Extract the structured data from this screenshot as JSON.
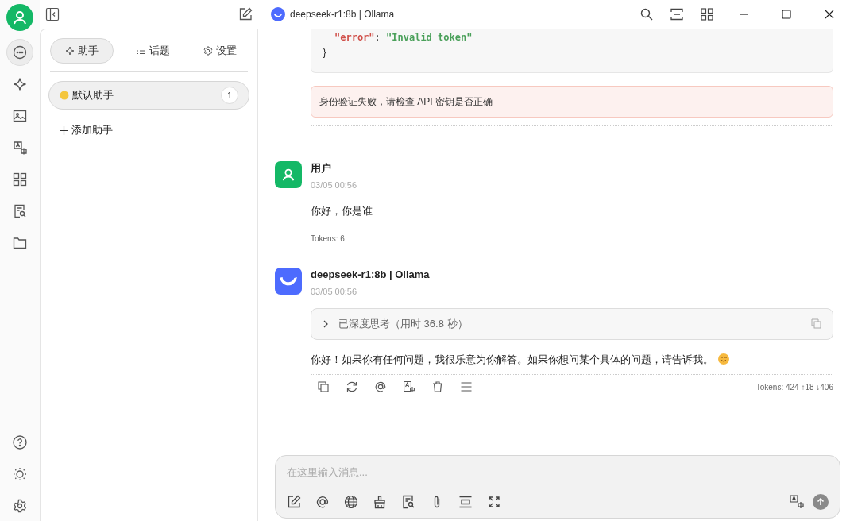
{
  "window": {
    "title": "deepseek-r1:8b | Ollama"
  },
  "rail": [
    {
      "kind": "chat",
      "selected": true
    },
    {
      "kind": "sparkle",
      "selected": false
    },
    {
      "kind": "image",
      "selected": false
    },
    {
      "kind": "translate",
      "selected": false
    },
    {
      "kind": "apps",
      "selected": false
    },
    {
      "kind": "docsearch",
      "selected": false
    },
    {
      "kind": "folder",
      "selected": false
    }
  ],
  "panel": {
    "tabs": [
      {
        "label": "助手",
        "kind": "sparkle",
        "selected": true
      },
      {
        "label": "话题",
        "kind": "list",
        "selected": false
      },
      {
        "label": "设置",
        "kind": "gear",
        "selected": false
      }
    ],
    "assistants": [
      {
        "name": "默认助手",
        "count": "1",
        "selected": true
      }
    ],
    "add_button": "添加助手"
  },
  "code_block": {
    "lines": [
      [
        {
          "text": "\"error\"",
          "kind": "key"
        },
        {
          "text": ": ",
          "kind": "punct"
        },
        {
          "text": "\"Invalid token\"",
          "kind": "string"
        }
      ],
      [
        {
          "text": "}",
          "kind": "punct"
        }
      ]
    ]
  },
  "error_alert": "身份验证失败，请检查 API 密钥是否正确",
  "messages": [
    {
      "kind": "user",
      "name": "用户",
      "time": "03/05 00:56",
      "text": "你好，你是谁",
      "tokens": "Tokens: 6"
    },
    {
      "kind": "assistant",
      "name": "deepseek-r1:8b | Ollama",
      "time": "03/05 00:56",
      "thinking": {
        "label": "已深度思考（用时 36.8 秒）",
        "expanded": false
      },
      "text": "你好！如果你有任何问题，我很乐意为你解答。如果你想问某个具体的问题，请告诉我。",
      "tokens": "Tokens: 424 ↑18 ↓406"
    }
  ],
  "input": {
    "placeholder": "在这里输入消息..."
  }
}
